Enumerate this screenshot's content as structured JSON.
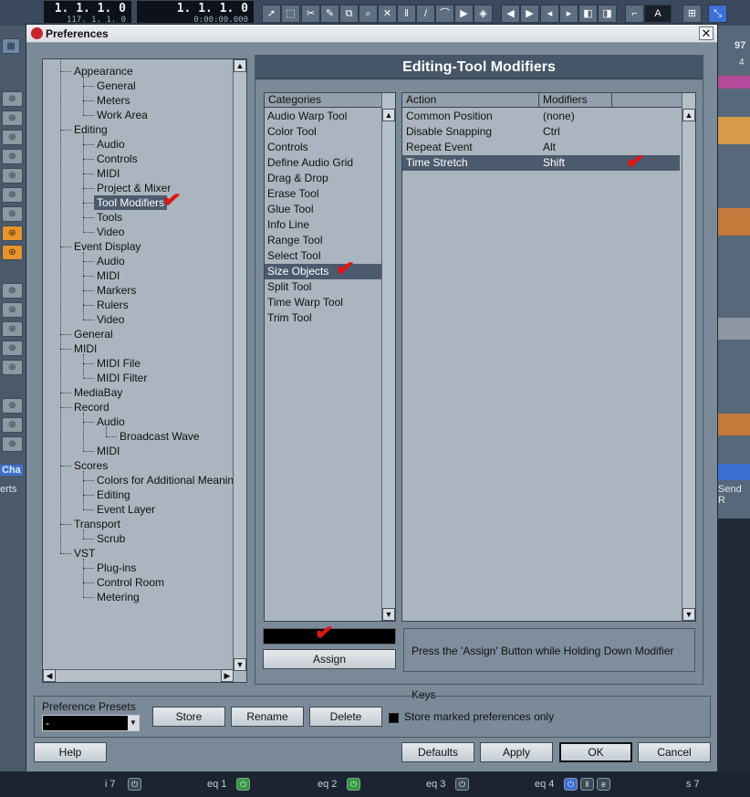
{
  "background": {
    "position_display": {
      "main": "1. 1. 1.   0",
      "sub": "117. 1. 1.   0"
    },
    "locator_display": {
      "main": "1. 1. 1.   0",
      "sub": "0:00:00.000"
    },
    "toolbar_letter": "A",
    "ruler_number": "97",
    "ruler_sub": "4",
    "left_label": "Cha",
    "left_label2": "erts",
    "right_label": "Send R",
    "channel_strip": [
      "i 7",
      "eq 1",
      "eq 2",
      "eq 3",
      "eq 4",
      "s 7"
    ]
  },
  "dialog": {
    "title": "Preferences",
    "close_glyph": "✕",
    "tree": {
      "items": [
        {
          "label": "Appearance"
        },
        {
          "label": "General"
        },
        {
          "label": "Meters"
        },
        {
          "label": "Work Area"
        },
        {
          "label": "Editing"
        },
        {
          "label": "Audio"
        },
        {
          "label": "Controls"
        },
        {
          "label": "MIDI"
        },
        {
          "label": "Project & Mixer"
        },
        {
          "label": "Tool Modifiers",
          "selected": true
        },
        {
          "label": "Tools"
        },
        {
          "label": "Video"
        },
        {
          "label": "Event Display"
        },
        {
          "label": "Audio"
        },
        {
          "label": "MIDI"
        },
        {
          "label": "Markers"
        },
        {
          "label": "Rulers"
        },
        {
          "label": "Video"
        },
        {
          "label": "General"
        },
        {
          "label": "MIDI"
        },
        {
          "label": "MIDI File"
        },
        {
          "label": "MIDI Filter"
        },
        {
          "label": "MediaBay"
        },
        {
          "label": "Record"
        },
        {
          "label": "Audio"
        },
        {
          "label": "Broadcast Wave"
        },
        {
          "label": "MIDI"
        },
        {
          "label": "Scores"
        },
        {
          "label": "Colors for Additional Meanings"
        },
        {
          "label": "Editing"
        },
        {
          "label": "Event Layer"
        },
        {
          "label": "Transport"
        },
        {
          "label": "Scrub"
        },
        {
          "label": "VST"
        },
        {
          "label": "Plug-ins"
        },
        {
          "label": "Control Room"
        },
        {
          "label": "Metering"
        }
      ]
    },
    "section_title": "Editing-Tool Modifiers",
    "categories": {
      "header": "Categories",
      "items": [
        "Audio Warp Tool",
        "Color Tool",
        "Controls",
        "Define Audio Grid",
        "Drag & Drop",
        "Erase Tool",
        "Glue Tool",
        "Info Line",
        "Range Tool",
        "Select Tool",
        "Size Objects",
        "Split Tool",
        "Time Warp Tool",
        "Trim Tool"
      ],
      "selected": "Size Objects"
    },
    "actions": {
      "header_action": "Action",
      "header_modifiers": "Modifiers",
      "rows": [
        {
          "action": "Common Position",
          "modifiers": "(none)"
        },
        {
          "action": "Disable Snapping",
          "modifiers": "Ctrl"
        },
        {
          "action": "Repeat Event",
          "modifiers": "Alt"
        },
        {
          "action": "Time Stretch",
          "modifiers": "Shift",
          "selected": true
        }
      ]
    },
    "assign_button": "Assign",
    "hint": "Press the 'Assign' Button while Holding Down Modifier Keys",
    "presets": {
      "label": "Preference Presets",
      "value": "-",
      "store": "Store",
      "rename": "Rename",
      "delete": "Delete",
      "store_marked": "Store marked preferences only"
    },
    "footer": {
      "help": "Help",
      "defaults": "Defaults",
      "apply": "Apply",
      "ok": "OK",
      "cancel": "Cancel"
    }
  }
}
